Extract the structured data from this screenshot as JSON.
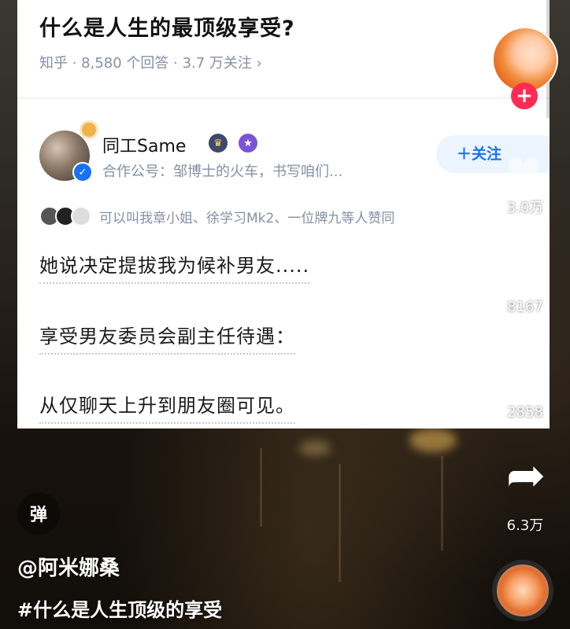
{
  "question": {
    "title": "什么是人生的最顶级享受?",
    "meta": "知乎 · 8,580 个回答 · 3.7 万关注 ›"
  },
  "author": {
    "name": "同工Same",
    "desc": "合作公号：邹博士的火车，书写咱们...",
    "follow_label": "＋关注"
  },
  "likers": "可以叫我章小姐、徐学习Mk2、一位牌九等人赞同",
  "paragraphs": [
    "她说决定提拔我为候补男友.....",
    "享受男友委员会副主任待遇：",
    "从仅聊天上升到朋友圈可见。"
  ],
  "actions": {
    "like_count": "3.0万",
    "comment_count": "8167",
    "favorite_count": "2858",
    "share_count": "6.3万",
    "plus_label": "+"
  },
  "danmu_label": "弹",
  "user_handle": "@阿米娜桑",
  "hashtag": "#什么是人生顶级的享受",
  "icons": {
    "like": "heart-icon",
    "comment": "comment-icon",
    "favorite": "star-icon",
    "share": "share-arrow-icon",
    "verified": "verified-check-icon",
    "crown_badge": "crown-icon",
    "creator_badge": "badge-icon"
  },
  "colors": {
    "accent_blue": "#1772f6",
    "follow_red": "#fe2c55"
  }
}
